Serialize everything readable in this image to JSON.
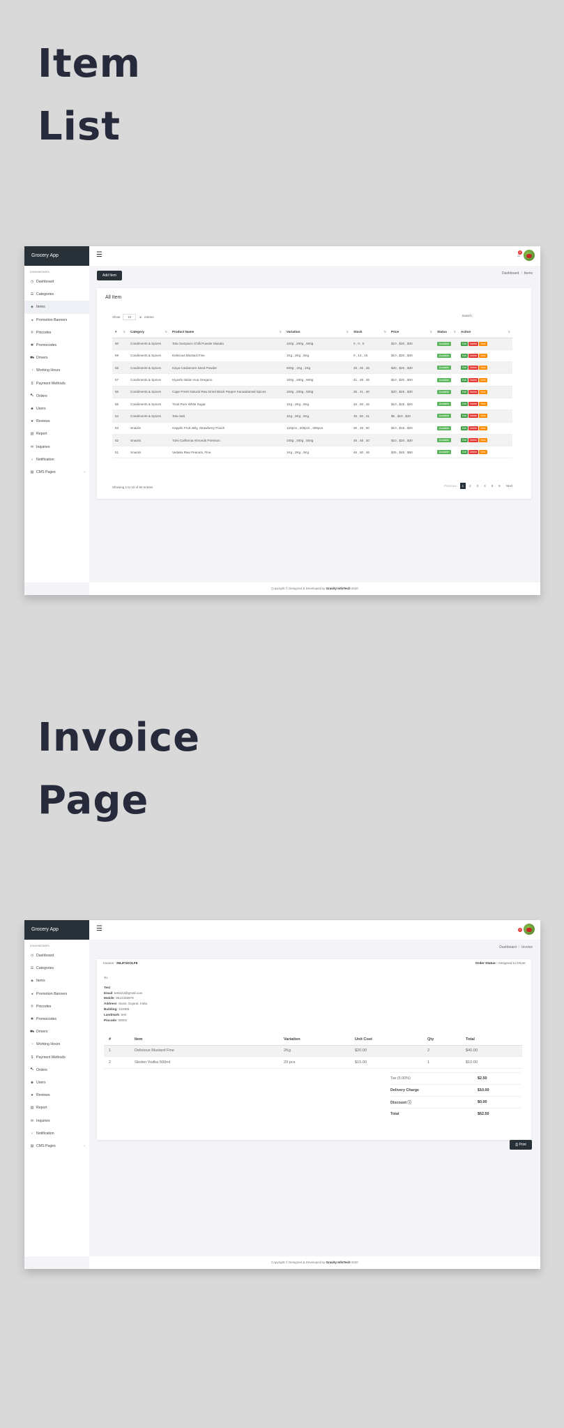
{
  "heading1": {
    "line1": "Item",
    "line2": "List"
  },
  "heading2": {
    "line1": "Invoice",
    "line2": "Page"
  },
  "app": {
    "brand": "Grocery App",
    "dashboard_caption": "DASHBOARD",
    "sidebar_items": [
      {
        "label": "Dashboard",
        "icon": "gauge-icon",
        "glyph": "◷"
      },
      {
        "label": "Categories",
        "icon": "list-icon",
        "glyph": "☰"
      },
      {
        "label": "Items",
        "icon": "box-icon",
        "glyph": "◈"
      },
      {
        "label": "Promotion Banners",
        "icon": "megaphone-icon",
        "glyph": "◂"
      },
      {
        "label": "Pincodes",
        "icon": "map-pin-icon",
        "glyph": "⚲"
      },
      {
        "label": "Promocodes",
        "icon": "tag-icon",
        "glyph": "✱"
      },
      {
        "label": "Drivers",
        "icon": "car-icon",
        "glyph": "⛟"
      },
      {
        "label": "Working Hours",
        "icon": "clock-icon",
        "glyph": "◔"
      },
      {
        "label": "Payment Methods",
        "icon": "dollar-icon",
        "glyph": "$"
      },
      {
        "label": "Orders",
        "icon": "cart-icon",
        "glyph": "⛍"
      },
      {
        "label": "Users",
        "icon": "users-icon",
        "glyph": "☻"
      },
      {
        "label": "Reviews",
        "icon": "star-icon",
        "glyph": "★"
      },
      {
        "label": "Report",
        "icon": "chart-icon",
        "glyph": "▥"
      },
      {
        "label": "Inquiries",
        "icon": "envelope-icon",
        "glyph": "✉"
      },
      {
        "label": "Notification",
        "icon": "bell-icon",
        "glyph": "♪"
      },
      {
        "label": "CMS Pages",
        "icon": "pages-icon",
        "glyph": "▤"
      }
    ],
    "cms_chevron": "›",
    "menu_glyph": "☰",
    "bell_glyph": "♫",
    "notif_count": "0",
    "footer": {
      "prefix": "Copyright © Designed & Developed by",
      "company": "Gravity InfoTech",
      "year": "2020"
    }
  },
  "item_list": {
    "add_button": "Add Item",
    "breadcrumb": [
      "Dashboard",
      "Items"
    ],
    "breadcrumb_sep": "/",
    "card_title": "All Item",
    "show_label": "Show",
    "show_value": "10",
    "entries_label": "entries",
    "entries_prefix": "⇲",
    "search_label": "Search:",
    "sort_glyph": "⇅",
    "columns": [
      "#",
      "Category",
      "Product Name",
      "Variation",
      "Stock",
      "Price",
      "Status",
      "Action"
    ],
    "rows": [
      [
        "60",
        "Condiments & Spices",
        "Tata Sampann Chilli Powder Masala",
        "100g , 200g , 500g",
        "0 , 0 , 0",
        "$10 , $20 , $30",
        "Available"
      ],
      [
        "59",
        "Condiments & Spices",
        "Delicious Mustard Fine",
        "1Kg , 2Kg , 5Kg",
        "0 , 14 , 15",
        "$10 , $20 , $30",
        "Available"
      ],
      [
        "58",
        "Condiments & Spices",
        "Kisya Cardamom Seed Powder",
        "500g , 1Kg , 2Kg",
        "46 , 46 , 46",
        "$20 , $25 , $30",
        "Available"
      ],
      [
        "57",
        "Condiments & Spices",
        "Hiyashi Italian Hua Oregano",
        "100g , 200g , 500g",
        "41 , 48 , 46",
        "$10 , $20 , $30",
        "Available"
      ],
      [
        "56",
        "Condiments & Spices",
        "Cape Fresh Natural Raw Dried Black Pepper Kanaabamali Spices",
        "100g , 200g , 500g",
        "25 , 41 , 40",
        "$20 , $25 , $30",
        "Available"
      ],
      [
        "55",
        "Condiments & Spices",
        "Trust Pure White Sugar",
        "1Kg , 2Kg , 5Kg",
        "46 , 50 , 45",
        "$10 , $15 , $20",
        "Available"
      ],
      [
        "54",
        "Condiments & Spices",
        "Tata Salt",
        "1Kg , 2Kg , 5Kg",
        "45 , 50 , 41",
        "$5 , $10 , $20",
        "Available"
      ],
      [
        "53",
        "Snacks",
        "Happilo Fruit Jelly, Strawberry Pouch",
        "120pcs , 200pcs , 300pcs",
        "30 , 48 , 50",
        "$10 , $15 , $20",
        "Available"
      ],
      [
        "52",
        "Snacks",
        "Tulsi California Almonds Premium",
        "100g , 200g , 500g",
        "46 , 48 , 40",
        "$10 , $20 , $30",
        "Available"
      ],
      [
        "51",
        "Snacks",
        "Vedaka Raw Peanuts, Fine",
        "1Kg , 2Kg , 5Kg",
        "46 , 50 , 46",
        "$25 , $45 , $60",
        "Available"
      ]
    ],
    "action_labels": [
      "Edit",
      "Delete",
      "View"
    ],
    "showing_text": "Showing 1 to 10 of 60 entries",
    "pagination": {
      "prev": "Previous",
      "pages": [
        "1",
        "2",
        "3",
        "4",
        "5",
        "6"
      ],
      "next": "Next",
      "current": "1"
    }
  },
  "invoice": {
    "breadcrumb": [
      "Dashboard",
      "Invoice"
    ],
    "invoice_label": "Invoice :",
    "invoice_no": "INLIF3XOLF8",
    "order_status_label": "Order Status :",
    "order_status": "Assigned to Driver",
    "to_label": "To:",
    "customer": "Test",
    "address_fields": [
      {
        "k": "Email",
        "v": "test123@gmail.com"
      },
      {
        "k": "Mobile",
        "v": "9612345678"
      },
      {
        "k": "Address",
        "v": "Surat, Gujarat, India"
      },
      {
        "k": "Building",
        "v": "123456"
      },
      {
        "k": "Landmark",
        "v": "test"
      },
      {
        "k": "Pincode",
        "v": "00001"
      }
    ],
    "columns": [
      "#",
      "Item",
      "Variation",
      "Unit Cost",
      "Qty",
      "Total"
    ],
    "rows": [
      [
        "1",
        "Delicious Mustard Fine",
        "2Kg",
        "$20.00",
        "2",
        "$40.00"
      ],
      [
        "2",
        "Skolen Vodka 500ml",
        "20 pcs",
        "$15.00",
        "1",
        "$10.00"
      ]
    ],
    "totals": [
      {
        "k": "Tax (5.00%)",
        "v": "$2.50",
        "plain": true
      },
      {
        "k": "Delivery Charge",
        "v": "$10.00",
        "plain": false
      },
      {
        "k": "Discount ⓘ",
        "v": "$0.00",
        "plain": false
      },
      {
        "k": "Total",
        "v": "$62.50",
        "plain": false
      }
    ],
    "print_label": "⎙ Print"
  },
  "colors": {
    "sidebar_brand": "#283038",
    "available": "#5cb85c",
    "edit": "#43a047",
    "delete": "#e53935",
    "view": "#fb8c00"
  }
}
